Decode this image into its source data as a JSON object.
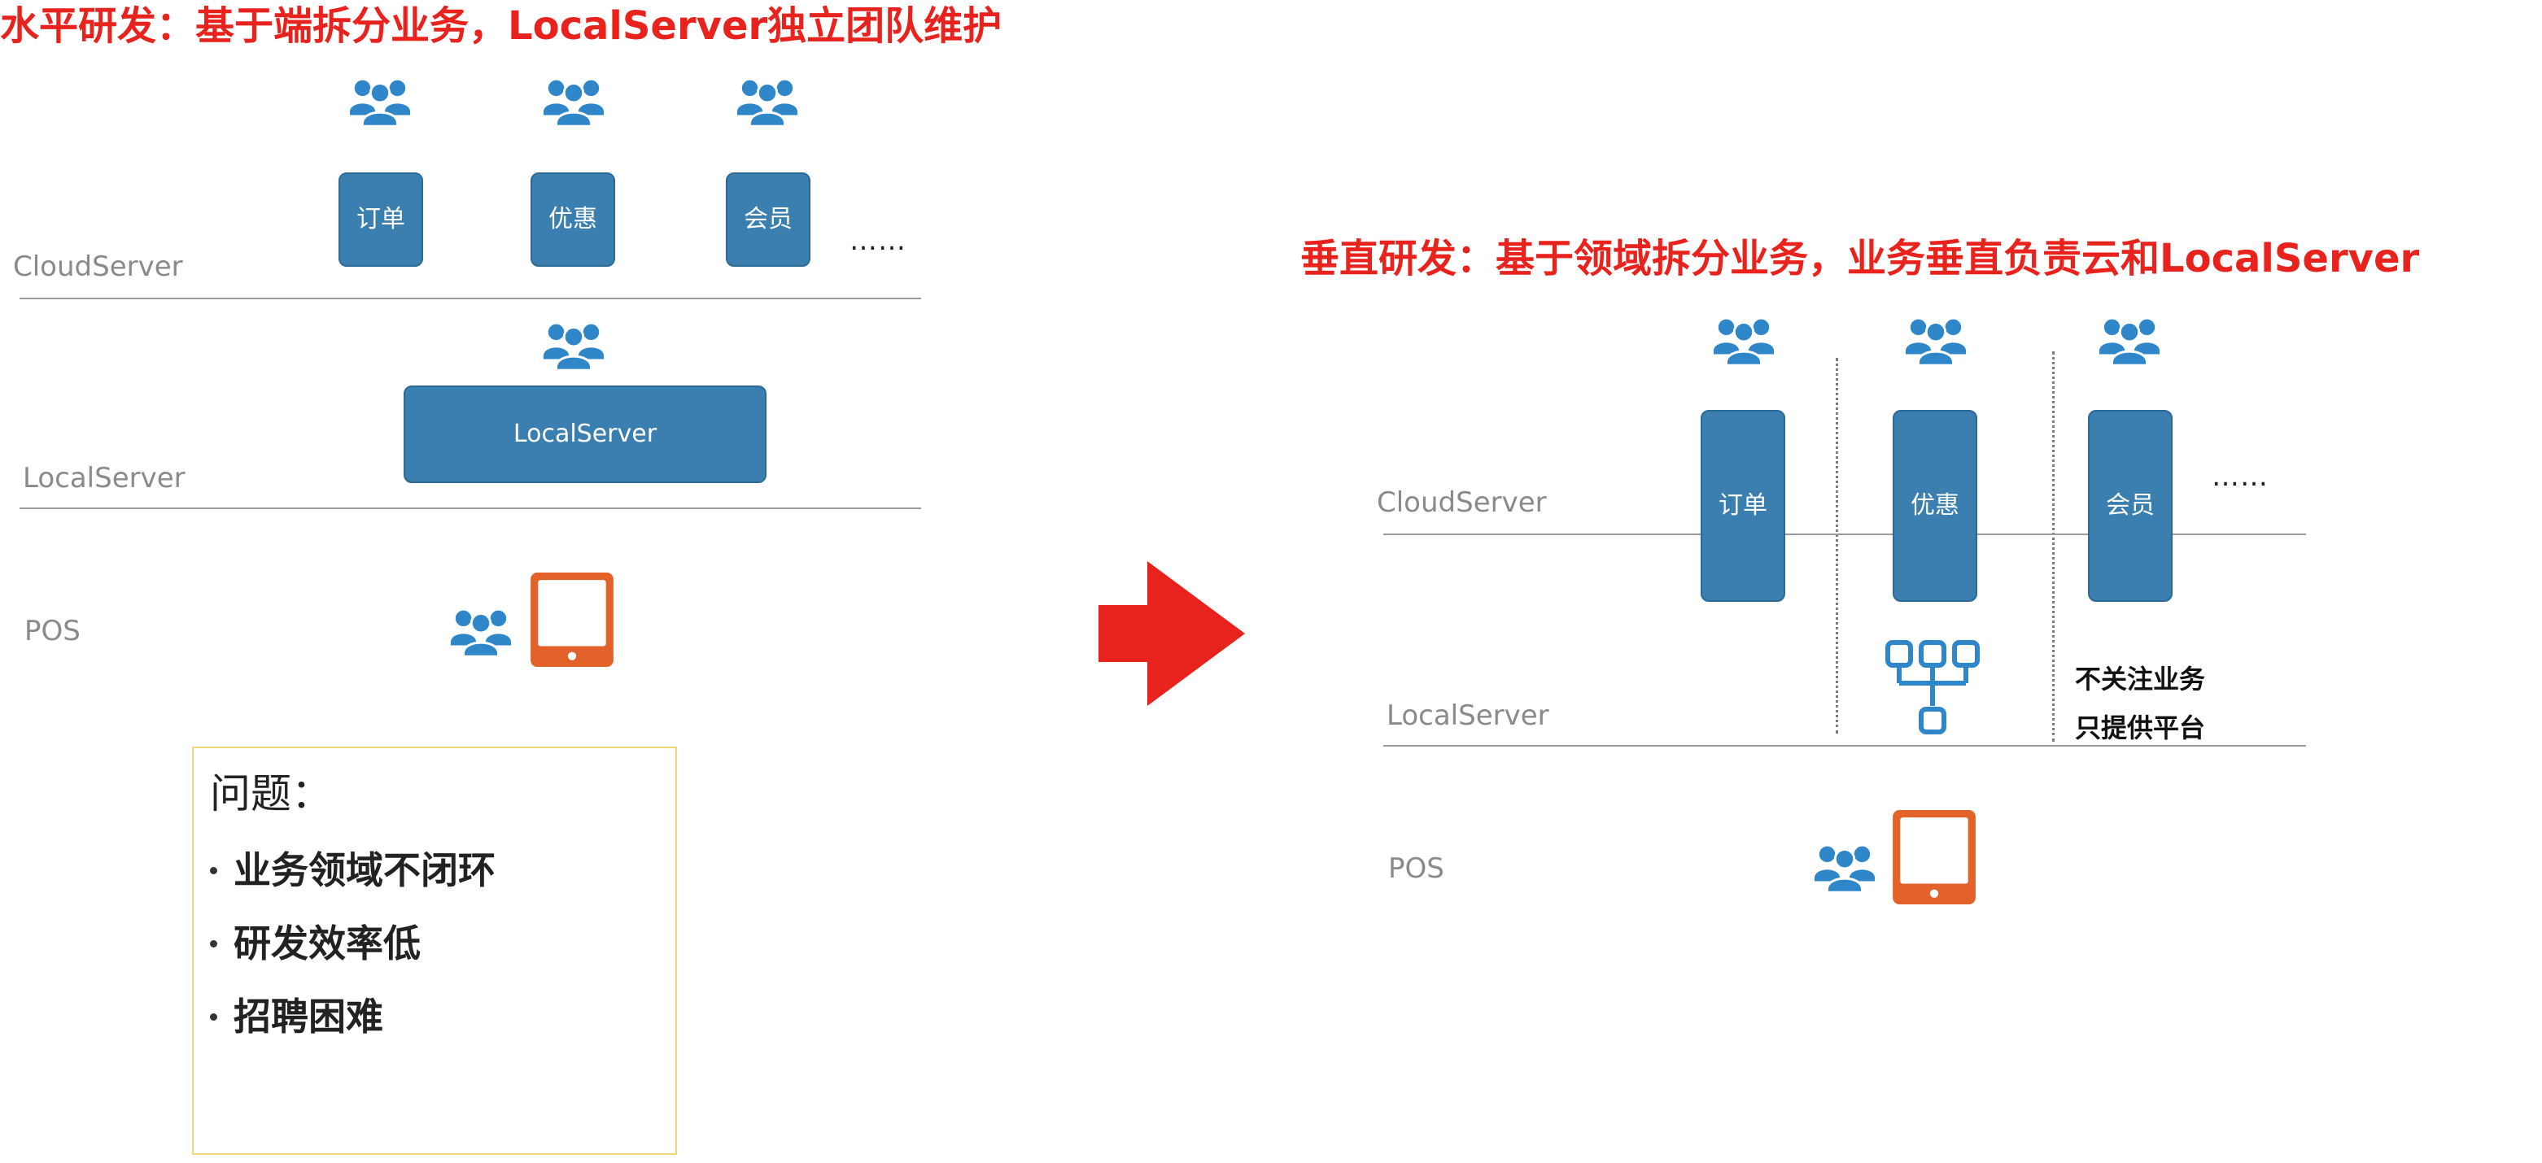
{
  "left": {
    "title": "水平研发：基于端拆分业务，LocalServer独立团队维护",
    "layers": {
      "cloud": "CloudServer",
      "local": "LocalServer",
      "pos": "POS"
    },
    "cloud_modules": [
      "订单",
      "优惠",
      "会员"
    ],
    "ellipsis": "……",
    "localserver_box": "LocalServer",
    "problem": {
      "title": "问题：",
      "items": [
        "业务领域不闭环",
        "研发效率低",
        "招聘困难"
      ]
    }
  },
  "right": {
    "title": "垂直研发：基于领域拆分业务，业务垂直负责云和LocalServer",
    "layers": {
      "cloud": "CloudServer",
      "local": "LocalServer",
      "pos": "POS"
    },
    "modules": [
      "订单",
      "优惠",
      "会员"
    ],
    "ellipsis": "……",
    "note": [
      "不关注业务",
      "只提供平台"
    ]
  },
  "colors": {
    "title_red": "#e8231d",
    "module_blue": "#3a7fb0",
    "team_icon_blue": "#2f86c8",
    "pos_orange": "#e2622a",
    "arrow_red": "#e8231d",
    "problem_border": "#f0d67a"
  },
  "icons": {
    "team": "users-group-icon",
    "pos": "tablet-icon",
    "platform": "org-structure-icon",
    "arrow": "arrow-right-icon"
  }
}
